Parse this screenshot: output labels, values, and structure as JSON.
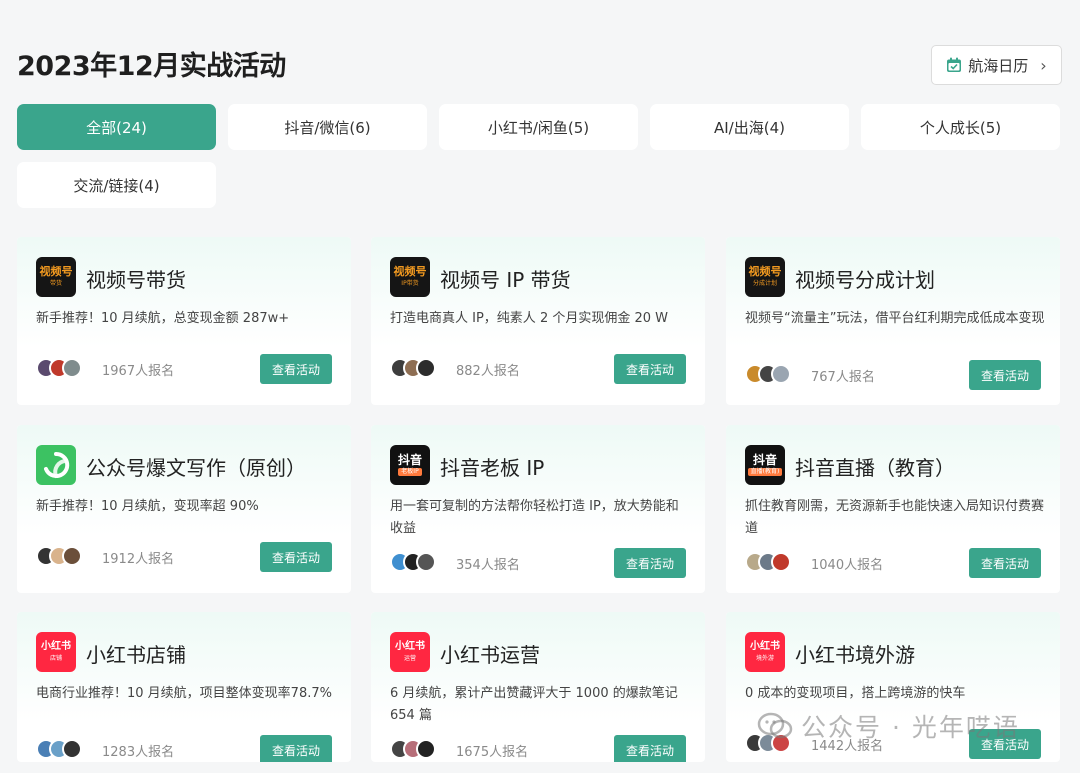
{
  "page_title": "2023年12月实战活动",
  "calendar_button": {
    "label": "航海日历",
    "icon": "calendar-check-icon"
  },
  "tabs": [
    {
      "label": "全部(24)",
      "active": true
    },
    {
      "label": "抖音/微信(6)"
    },
    {
      "label": "小红书/闲鱼(5)"
    },
    {
      "label": "AI/出海(4)"
    },
    {
      "label": "个人成长(5)"
    },
    {
      "label": "交流/链接(4)"
    }
  ],
  "view_label": "查看活动",
  "cards": [
    {
      "title": "视频号带货",
      "desc": "新手推荐！10 月续航，总变现金额 287w+",
      "count": "1967人报名",
      "logo": {
        "text": "视频号",
        "sub": "带货",
        "style": "dark"
      }
    },
    {
      "title": "视频号 IP 带货",
      "desc": "打造电商真人 IP，纯素人 2 个月实现佣金 20 W",
      "count": "882人报名",
      "logo": {
        "text": "视频号",
        "sub": "IP带货",
        "style": "dark"
      }
    },
    {
      "title": "视频号分成计划",
      "desc": "视频号“流量主”玩法，借平台红利期完成低成本变现",
      "count": "767人报名",
      "logo": {
        "text": "视频号",
        "sub": "分成计划",
        "style": "dark"
      }
    },
    {
      "title": "公众号爆文写作（原创）",
      "desc": "新手推荐！10 月续航，变现率超 90%",
      "count": "1912人报名",
      "logo": {
        "text": "",
        "sub": "",
        "style": "green"
      }
    },
    {
      "title": "抖音老板 IP",
      "desc": "用一套可复制的方法帮你轻松打造 IP，放大势能和收益",
      "count": "354人报名",
      "logo": {
        "text": "抖音",
        "sub": "老板IP",
        "style": "douyin"
      }
    },
    {
      "title": "抖音直播（教育）",
      "desc": "抓住教育刚需，无资源新手也能快速入局知识付费赛道",
      "count": "1040人报名",
      "logo": {
        "text": "抖音",
        "sub": "直播(教育)",
        "style": "douyin"
      }
    },
    {
      "title": "小红书店铺",
      "desc": "电商行业推荐！10 月续航，项目整体变现率78.7%",
      "count": "1283人报名",
      "logo": {
        "text": "小红书",
        "sub": "店铺",
        "style": "red"
      }
    },
    {
      "title": "小红书运营",
      "desc": "6 月续航，累计产出赞藏评大于 1000 的爆款笔记 654 篇",
      "count": "1675人报名",
      "logo": {
        "text": "小红书",
        "sub": "运营",
        "style": "red"
      }
    },
    {
      "title": "小红书境外游",
      "desc": "0 成本的变现项目，搭上跨境游的快车",
      "count": "1442人报名",
      "logo": {
        "text": "小红书",
        "sub": "境外游",
        "style": "red"
      }
    }
  ],
  "avatar_colors": [
    [
      "#5a4a6e",
      "#c0392b",
      "#7f8c8d"
    ],
    [
      "#3d3d3d",
      "#8e6e53",
      "#2c2c2c"
    ],
    [
      "#c98a2b",
      "#444",
      "#9aa5b1"
    ],
    [
      "#333",
      "#d9b38c",
      "#6b4f3a"
    ],
    [
      "#3f8fd0",
      "#222",
      "#555"
    ],
    [
      "#b8a98a",
      "#6c7a89",
      "#c0392b"
    ],
    [
      "#4a7fb5",
      "#6aa0c8",
      "#333"
    ],
    [
      "#444",
      "#b76e79",
      "#222"
    ],
    [
      "#3a3a3a",
      "#7c8b99",
      "#c44"
    ]
  ],
  "watermark": "公众号 · 光年呓语"
}
